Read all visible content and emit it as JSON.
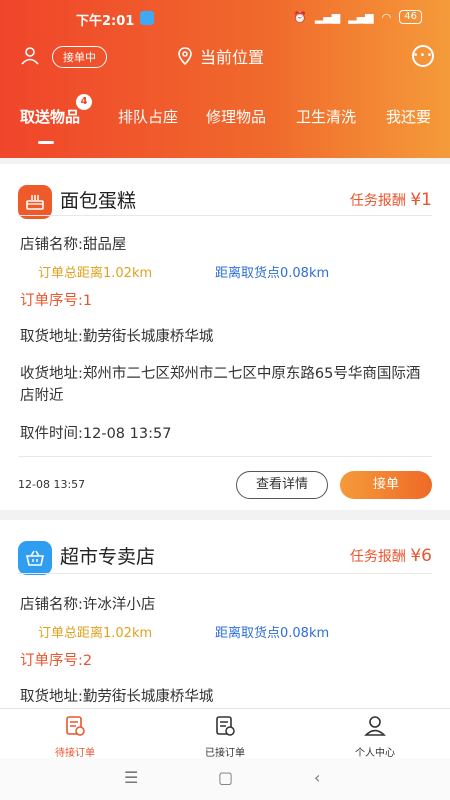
{
  "status": {
    "time": "下午2:01",
    "battery": "46"
  },
  "topbar": {
    "accepting_label": "接单中",
    "location_label": "当前位置"
  },
  "tabs": [
    {
      "label": "取送物品",
      "badge": "4"
    },
    {
      "label": "排队占座"
    },
    {
      "label": "修理物品"
    },
    {
      "label": "卫生清洗"
    },
    {
      "label": "我还要"
    }
  ],
  "orders": [
    {
      "category": "面包蛋糕",
      "reward_label": "任务报酬",
      "reward_amount": "¥1",
      "shop_line": "店铺名称:甜品屋",
      "total_distance": "订单总距离1.02km",
      "pickup_distance": "距离取货点0.08km",
      "serial": "订单序号:1",
      "pickup_address": "取货地址:勤劳街长城康桥华城",
      "delivery_address": "收货地址:郑州市二七区郑州市二七区中原东路65号华商国际酒店附近",
      "pickup_time": "取件时间:12-08 13:57",
      "footer_time": "12-08 13:57",
      "detail_label": "查看详情",
      "accept_label": "接单",
      "icon_color": "#ef5a2a"
    },
    {
      "category": "超市专卖店",
      "reward_label": "任务报酬",
      "reward_amount": "¥6",
      "shop_line": "店铺名称:许冰洋小店",
      "total_distance": "订单总距离1.02km",
      "pickup_distance": "距离取货点0.08km",
      "serial": "订单序号:2",
      "pickup_address": "取货地址:勤劳街长城康桥华城",
      "icon_color": "#2f9ef0"
    }
  ],
  "bottom_nav": [
    {
      "label": "待接订单"
    },
    {
      "label": "已接订单"
    },
    {
      "label": "个人中心"
    }
  ],
  "colors": {
    "accent": "#f0452b",
    "reward": "#e8562d",
    "distance_orange": "#e0a21f",
    "distance_blue": "#2f6fd8"
  }
}
